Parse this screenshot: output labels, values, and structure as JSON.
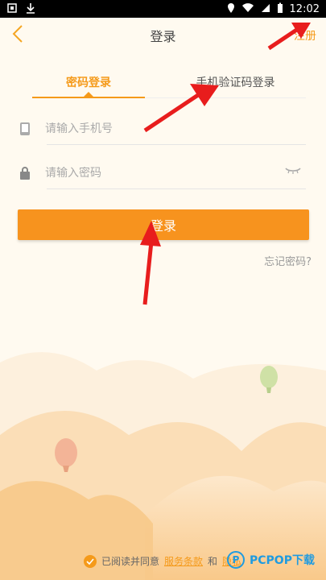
{
  "status_bar": {
    "left_icons": [
      "carrier-icon",
      "download-icon"
    ],
    "right_icons": [
      "location-icon",
      "wifi-icon",
      "signal-icon",
      "battery-icon"
    ],
    "time": "12:02"
  },
  "header": {
    "title": "登录",
    "register_label": "注册"
  },
  "tabs": {
    "password_login": "密码登录",
    "sms_login": "手机验证码登录"
  },
  "fields": {
    "phone_placeholder": "请输入手机号",
    "password_placeholder": "请输入密码"
  },
  "login_button_label": "登录",
  "forgot_password_label": "忘记密码?",
  "agreement": {
    "prefix": "已阅读并同意",
    "terms_link": "服务条款",
    "conjunction": "和",
    "privacy_link": "隐私"
  },
  "watermark": {
    "text": "PCPOP下载"
  },
  "colors": {
    "accent": "#f59a1a",
    "button": "#f7931e",
    "arrow": "#e81d1d"
  }
}
